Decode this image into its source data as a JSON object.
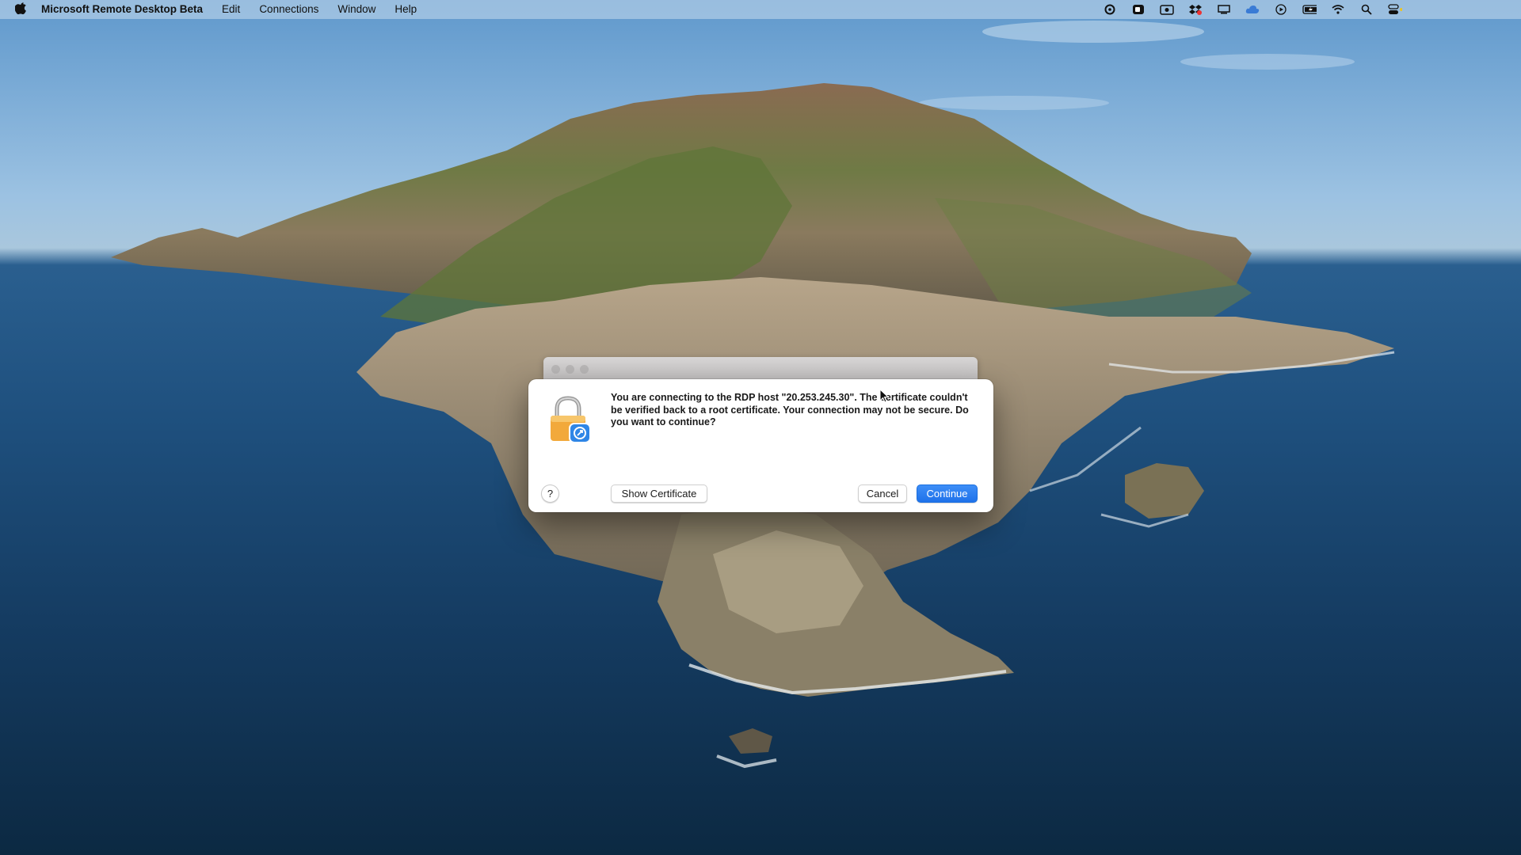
{
  "menubar": {
    "app_name": "Microsoft Remote Desktop Beta",
    "items": [
      "Edit",
      "Connections",
      "Window",
      "Help"
    ],
    "status_icons": [
      "creative-cloud-icon",
      "zoom-icon",
      "screen-capture-icon",
      "dropbox-icon",
      "display-icon",
      "cloud-icon",
      "play-icon",
      "battery-icon",
      "wifi-icon",
      "spotlight-search-icon",
      "control-center-icon"
    ]
  },
  "dialog": {
    "message": "You are connecting to the RDP host \"20.253.245.30\". The certificate couldn't be verified back to a root certificate. Your connection may not be secure. Do you want to continue?",
    "help_label": "?",
    "show_certificate_label": "Show Certificate",
    "cancel_label": "Cancel",
    "continue_label": "Continue"
  },
  "colors": {
    "accent": "#1f72ea",
    "lock_body": "#f2a93b"
  }
}
